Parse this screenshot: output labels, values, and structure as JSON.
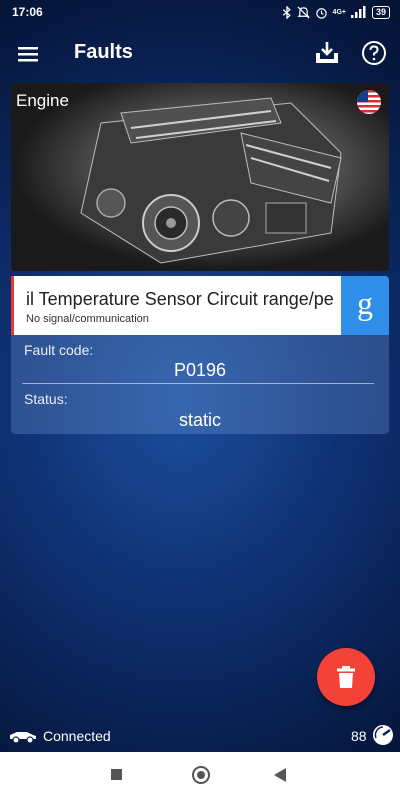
{
  "status_bar": {
    "time": "17:06",
    "signal_label": "4G+",
    "battery": "39",
    "icons": [
      "bluetooth-icon",
      "mute-icon",
      "alarm-icon",
      "signal-icon",
      "battery-icon"
    ]
  },
  "app_bar": {
    "title": "Faults",
    "icons": [
      "menu-icon",
      "download-icon",
      "help-icon"
    ]
  },
  "engine_card": {
    "title": "Engine",
    "icons": [
      "us-flag-icon",
      "engine-image"
    ]
  },
  "fault": {
    "description": "il Temperature Sensor Circuit range/pe",
    "subtitle": "No signal/communication",
    "search_label": "g",
    "fault_code_label": "Fault code:",
    "fault_code": "P0196",
    "status_label": "Status:",
    "status": "static",
    "accent_color": "#e53935"
  },
  "delete_button": {
    "icon": "trash-icon",
    "color": "#f44336"
  },
  "bottom_bar": {
    "connection": "Connected",
    "speed": "88",
    "icons": [
      "car-icon",
      "speedometer-icon"
    ]
  }
}
